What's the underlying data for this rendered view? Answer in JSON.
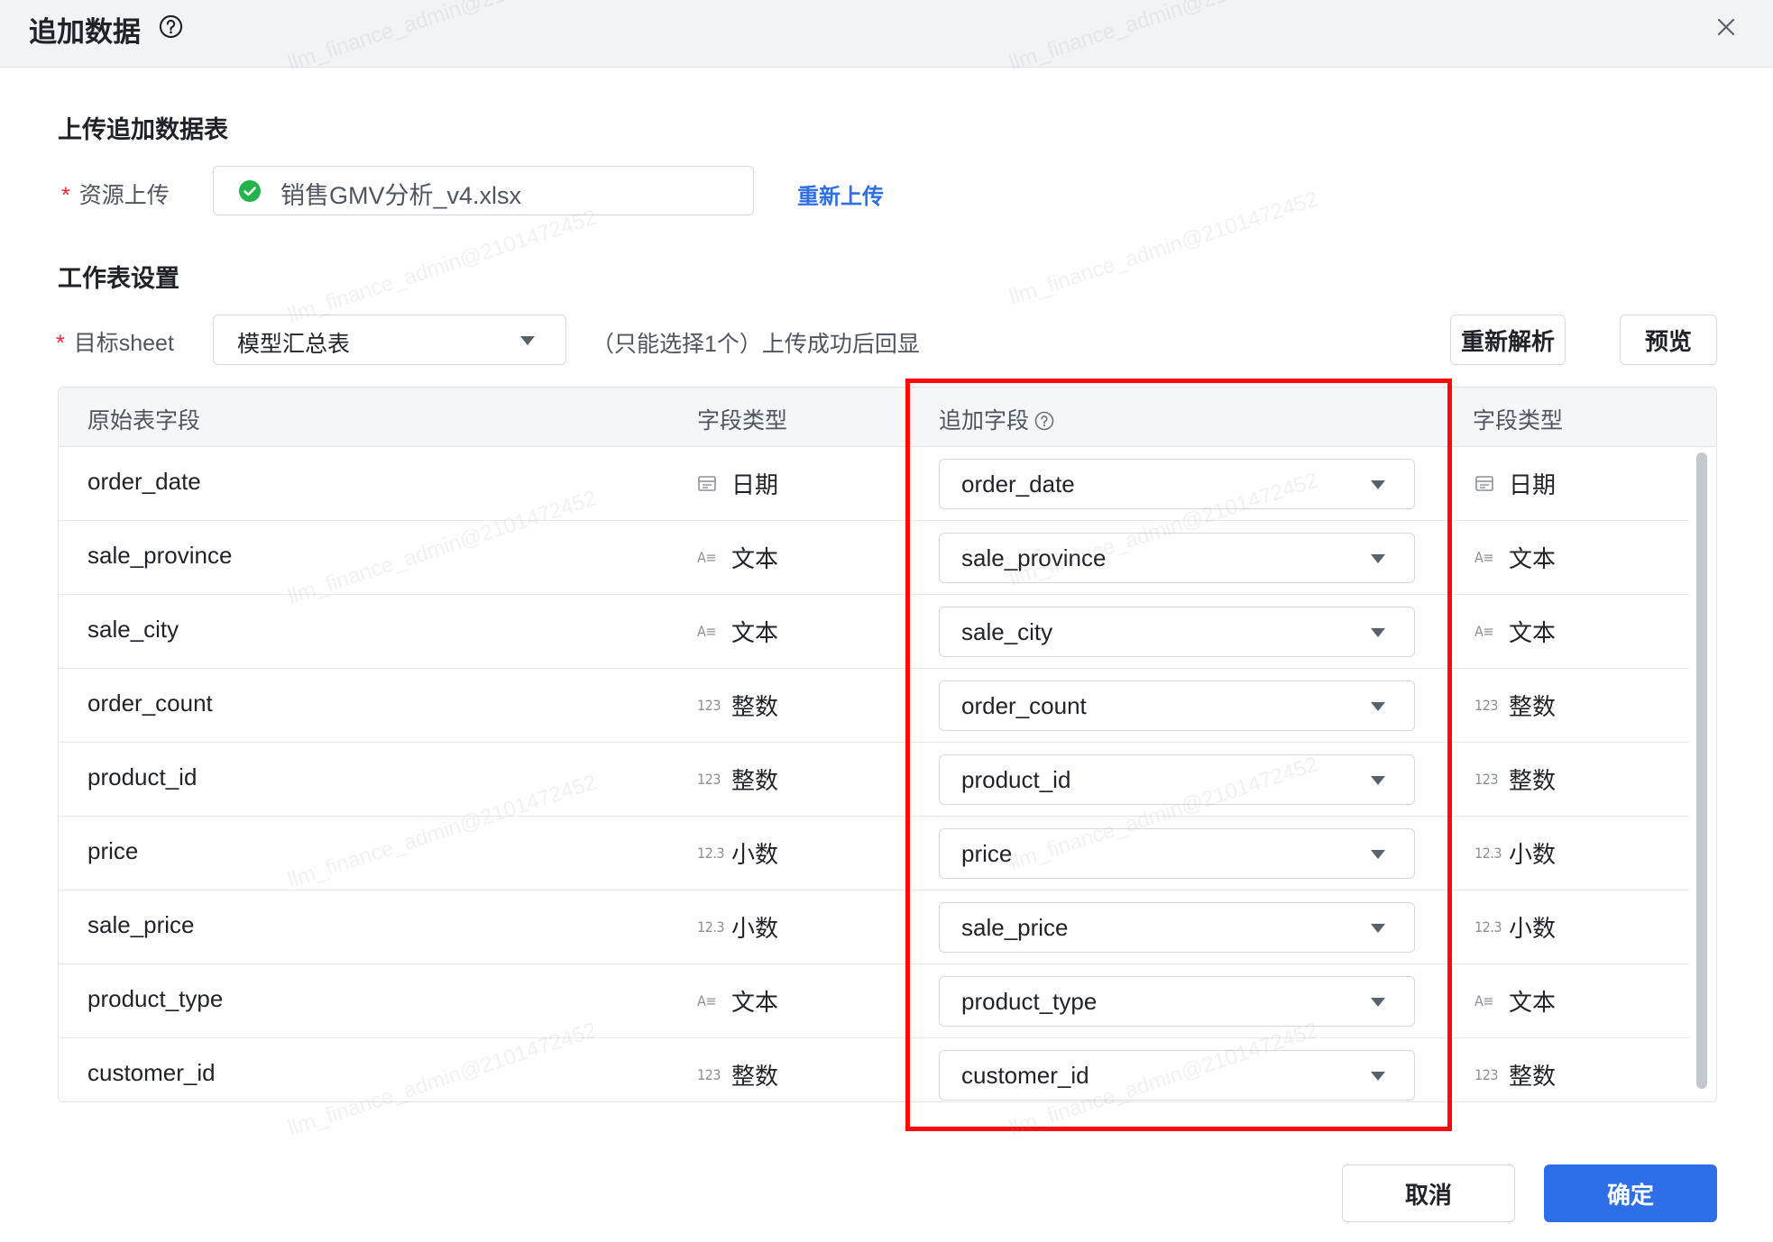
{
  "dialog": {
    "title": "追加数据",
    "upload_section_title": "上传追加数据表",
    "resource_label": "资源上传",
    "required_mark": "*",
    "file_name": "销售GMV分析_v4.xlsx",
    "reupload_label": "重新上传",
    "sheet_section_title": "工作表设置",
    "target_sheet_label": "目标sheet",
    "target_sheet_value": "模型汇总表",
    "target_sheet_hint": "（只能选择1个）上传成功后回显",
    "reparse_label": "重新解析",
    "preview_label": "预览",
    "cancel_label": "取消",
    "confirm_label": "确定",
    "watermark_text": "llm_finance_admin@2101472452"
  },
  "table": {
    "headers": {
      "source_field": "原始表字段",
      "source_type": "字段类型",
      "append_field": "追加字段",
      "append_type": "字段类型"
    },
    "rows": [
      {
        "source_field": "order_date",
        "source_type_icon": "calendar-icon",
        "source_type": "日期",
        "append_field": "order_date",
        "append_type_icon": "calendar-icon",
        "append_type": "日期"
      },
      {
        "source_field": "sale_province",
        "source_type_icon": "A≡",
        "source_type": "文本",
        "append_field": "sale_province",
        "append_type_icon": "A≡",
        "append_type": "文本"
      },
      {
        "source_field": "sale_city",
        "source_type_icon": "A≡",
        "source_type": "文本",
        "append_field": "sale_city",
        "append_type_icon": "A≡",
        "append_type": "文本"
      },
      {
        "source_field": "order_count",
        "source_type_icon": "123",
        "source_type": "整数",
        "append_field": "order_count",
        "append_type_icon": "123",
        "append_type": "整数"
      },
      {
        "source_field": "product_id",
        "source_type_icon": "123",
        "source_type": "整数",
        "append_field": "product_id",
        "append_type_icon": "123",
        "append_type": "整数"
      },
      {
        "source_field": "price",
        "source_type_icon": "12.3",
        "source_type": "小数",
        "append_field": "price",
        "append_type_icon": "12.3",
        "append_type": "小数"
      },
      {
        "source_field": "sale_price",
        "source_type_icon": "12.3",
        "source_type": "小数",
        "append_field": "sale_price",
        "append_type_icon": "12.3",
        "append_type": "小数"
      },
      {
        "source_field": "product_type",
        "source_type_icon": "A≡",
        "source_type": "文本",
        "append_field": "product_type",
        "append_type_icon": "A≡",
        "append_type": "文本"
      },
      {
        "source_field": "customer_id",
        "source_type_icon": "123",
        "source_type": "整数",
        "append_field": "customer_id",
        "append_type_icon": "123",
        "append_type": "整数"
      }
    ]
  },
  "colors": {
    "primary": "#2e6fe8",
    "highlight_border": "#ff0a0a",
    "success": "#22b34b",
    "required": "#f5222d"
  }
}
